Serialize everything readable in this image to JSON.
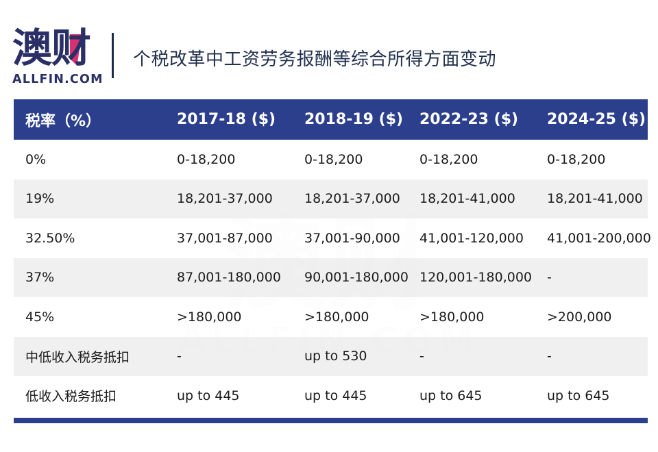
{
  "header": {
    "logo": {
      "chinese": "澳财",
      "latin": "ALLFIN.COM",
      "accent_color": "#d9316d",
      "brand_color": "#2a2f66"
    },
    "title": "个税改革中工资劳务报酬等综合所得方面变动"
  },
  "watermark": {
    "chinese": "澳财",
    "latin": "ALLFIN.COM"
  },
  "table": {
    "header_bg": "#2b3f8c",
    "stripe_color": "#eeeeee",
    "columns": [
      "税率（%）",
      "2017-18 ($)",
      "2018-19 ($)",
      "2022-23 ($)",
      "2024-25 ($)"
    ],
    "rows": [
      {
        "rate": "0%",
        "y2017_18": "0-18,200",
        "y2018_19": "0-18,200",
        "y2022_23": "0-18,200",
        "y2024_25": "0-18,200"
      },
      {
        "rate": "19%",
        "y2017_18": "18,201-37,000",
        "y2018_19": "18,201-37,000",
        "y2022_23": "18,201-41,000",
        "y2024_25": "18,201-41,000"
      },
      {
        "rate": "32.50%",
        "y2017_18": "37,001-87,000",
        "y2018_19": "37,001-90,000",
        "y2022_23": "41,001-120,000",
        "y2024_25": "41,001-200,000"
      },
      {
        "rate": "37%",
        "y2017_18": "87,001-180,000",
        "y2018_19": "90,001-180,000",
        "y2022_23": "120,001-180,000",
        "y2024_25": "-"
      },
      {
        "rate": "45%",
        "y2017_18": ">180,000",
        "y2018_19": ">180,000",
        "y2022_23": ">180,000",
        "y2024_25": ">200,000"
      },
      {
        "rate": "中低收入税务抵扣",
        "y2017_18": "-",
        "y2018_19": "up to 530",
        "y2022_23": "-",
        "y2024_25": "-"
      },
      {
        "rate": "低收入税务抵扣",
        "y2017_18": "up to 445",
        "y2018_19": "up to 445",
        "y2022_23": "up to 645",
        "y2024_25": "up to 645"
      }
    ]
  }
}
